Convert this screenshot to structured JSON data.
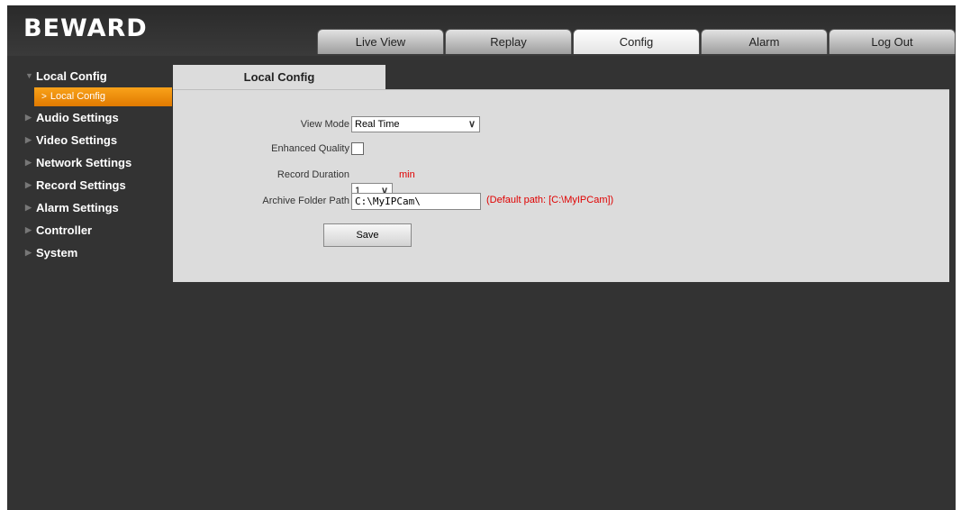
{
  "brand": {
    "logo_text": "BEWARD"
  },
  "tabs": [
    {
      "label": "Live View",
      "active": false
    },
    {
      "label": "Replay",
      "active": false
    },
    {
      "label": "Config",
      "active": true
    },
    {
      "label": "Alarm",
      "active": false
    },
    {
      "label": "Log Out",
      "active": false
    }
  ],
  "sidebar": {
    "groups": [
      {
        "label": "Local Config",
        "expanded": true
      },
      {
        "label": "Audio Settings"
      },
      {
        "label": "Video Settings"
      },
      {
        "label": "Network Settings"
      },
      {
        "label": "Record Settings"
      },
      {
        "label": "Alarm Settings"
      },
      {
        "label": "Controller"
      },
      {
        "label": "System"
      }
    ],
    "active_sub": {
      "label": "Local Config",
      "chevron": ">"
    }
  },
  "content": {
    "tab_title": "Local Config",
    "view_mode": {
      "label": "View Mode",
      "value": "Real Time"
    },
    "enhanced_quality": {
      "label": "Enhanced Quality",
      "checked": false
    },
    "record_duration": {
      "label": "Record Duration",
      "value": "1",
      "unit": "min"
    },
    "archive_path": {
      "label": "Archive Folder Path",
      "value": "C:\\MyIPCam\\",
      "hint": "(Default path: [C:\\MyIPCam])"
    },
    "save_label": "Save"
  },
  "colors": {
    "accent": "#f59a12",
    "background": "#333333",
    "panel": "#dcdcdc",
    "hint": "#e00000"
  },
  "icons": {
    "collapsed_arrow": "triangle-right-icon",
    "expanded_arrow": "triangle-down-icon",
    "dropdown": "chevron-down-icon"
  }
}
